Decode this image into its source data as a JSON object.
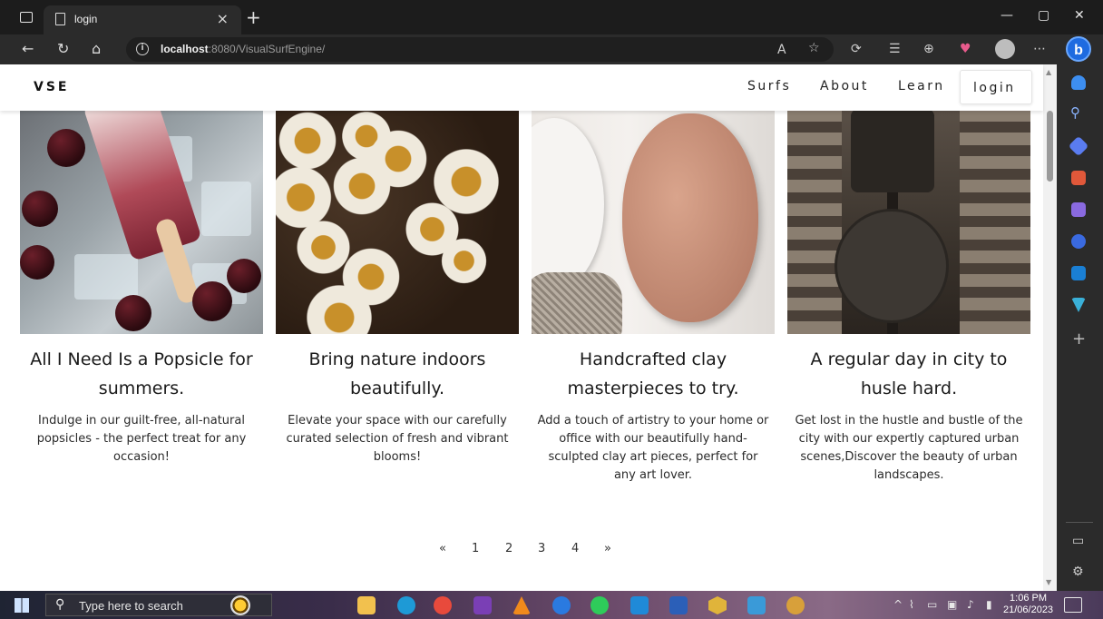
{
  "browser": {
    "tab_title": "login",
    "tab_close": "×",
    "new_tab": "+",
    "url_host": "localhost",
    "url_rest": ":8080/VisualSurfEngine/",
    "window_controls": [
      "—",
      "▢",
      "✕"
    ],
    "bing_label": "b"
  },
  "site": {
    "brand": "VSE",
    "nav": [
      "Surfs",
      "About",
      "Learn"
    ],
    "login_label": "login"
  },
  "cards": [
    {
      "title": "All I Need Is a Popsicle for summers.",
      "body": "Indulge in our guilt-free, all-natural popsicles - the perfect treat for any occasion!",
      "image": "popsicle-image"
    },
    {
      "title": "Bring nature indoors beautifully.",
      "body": "Elevate your space with our carefully curated selection of fresh and vibrant blooms!",
      "image": "daisies-image"
    },
    {
      "title": "Handcrafted clay masterpieces to try.",
      "body": "Add a touch of artistry to your home or office with our beautifully hand-sculpted clay art pieces, perfect for any art lover.",
      "image": "clay-art-image"
    },
    {
      "title": "A regular day in city to husle hard.",
      "body": "Get lost in the hustle and bustle of the city with our expertly captured urban scenes,Discover the beauty of urban landscapes.",
      "image": "city-street-image"
    }
  ],
  "pagination": {
    "prev": "«",
    "pages": [
      "1",
      "2",
      "3",
      "4"
    ],
    "next": "»"
  },
  "taskbar": {
    "search_placeholder": "Type here to search",
    "time": "1:06 PM",
    "date": "21/06/2023"
  },
  "colors": {
    "page_bg": "#ffffff",
    "chrome_dark": "#2b2b2b",
    "text": "#1a1a1a",
    "bing_blue": "#1e6be0"
  }
}
